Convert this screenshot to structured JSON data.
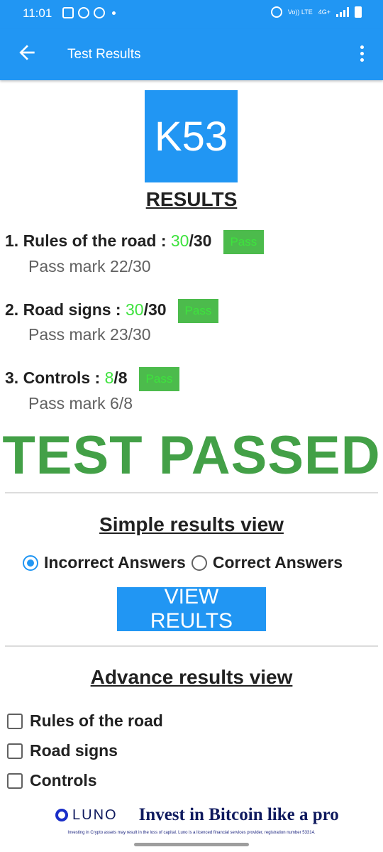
{
  "status": {
    "time": "11:01",
    "left_icons": [
      "gallery-icon",
      "timer-icon",
      "pinterest-icon",
      "dot-icon"
    ],
    "right_icons": [
      "alarm-icon",
      "volte-icon",
      "4g-icon",
      "signal-icon",
      "battery-icon"
    ],
    "volte_label": "Vo)) LTE",
    "network_label": "4G+"
  },
  "app_bar": {
    "title": "Test Results",
    "back_icon": "arrow-left-icon",
    "menu_icon": "more-vertical-icon"
  },
  "logo": {
    "text": "K53"
  },
  "results_heading": "RESULTS",
  "scores": [
    {
      "number_label": "1. Rules of the road :",
      "score": "30",
      "total": "/30",
      "badge": "Pass",
      "pass_mark": "Pass mark  22/30"
    },
    {
      "number_label": "2. Road  signs :",
      "score": "30",
      "total": "/30",
      "badge": "Pass",
      "pass_mark": "Pass mark  23/30"
    },
    {
      "number_label": "3. Controls :",
      "score": "8",
      "total": "/8",
      "badge": "Pass",
      "pass_mark": "Pass mark  6/8"
    }
  ],
  "verdict": "TEST PASSED",
  "simple_view": {
    "heading": "Simple results view",
    "options": [
      {
        "label": "Incorrect Answers",
        "selected": true
      },
      {
        "label": "Correct Answers",
        "selected": false
      }
    ],
    "button_label": "VIEW REULTS"
  },
  "advance_view": {
    "heading": "Advance results view",
    "checkboxes": [
      {
        "label": "Rules of the road",
        "checked": false
      },
      {
        "label": "Road signs",
        "checked": false
      },
      {
        "label": "Controls",
        "checked": false
      }
    ]
  },
  "ad": {
    "brand": "LUNO",
    "headline": "Invest in Bitcoin like a pro",
    "disclaimer": "Investing in Crypto assets may result in the loss of capital. Luno is a licenced financial services provider, registration number 53314."
  },
  "colors": {
    "primary": "#2196f3",
    "pass_text": "#3ee23e",
    "pass_badge": "#4cbb4c",
    "verdict": "#43a047"
  }
}
